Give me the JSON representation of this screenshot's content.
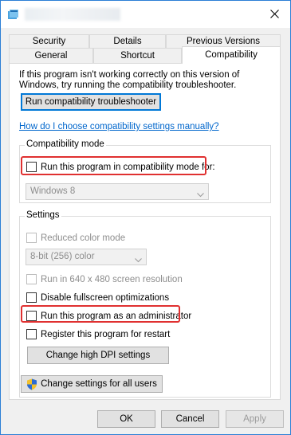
{
  "window": {
    "title": "Properties"
  },
  "tabs": {
    "row1": [
      {
        "label": "Security"
      },
      {
        "label": "Details"
      },
      {
        "label": "Previous Versions"
      }
    ],
    "row2": [
      {
        "label": "General"
      },
      {
        "label": "Shortcut"
      },
      {
        "label": "Compatibility"
      }
    ]
  },
  "compatibility": {
    "intro": "If this program isn't working correctly on this version of Windows, try running the compatibility troubleshooter.",
    "troubleshooter_button": "Run compatibility troubleshooter",
    "manual_link": "How do I choose compatibility settings manually?",
    "mode_group": {
      "label": "Compatibility mode",
      "checkbox_label": "Run this program in compatibility mode for:",
      "select_value": "Windows 8"
    },
    "settings_group": {
      "label": "Settings",
      "reduced_color_label": "Reduced color mode",
      "color_select_value": "8-bit (256) color",
      "resolution_label": "Run in 640 x 480 screen resolution",
      "fullscreen_label": "Disable fullscreen optimizations",
      "admin_label": "Run this program as an administrator",
      "restart_label": "Register this program for restart",
      "dpi_button": "Change high DPI settings"
    },
    "all_users_button": "Change settings for all users"
  },
  "footer": {
    "ok": "OK",
    "cancel": "Cancel",
    "apply": "Apply"
  },
  "colors": {
    "highlight": "#e03030",
    "link": "#0066cc",
    "accent": "#0078d7"
  }
}
